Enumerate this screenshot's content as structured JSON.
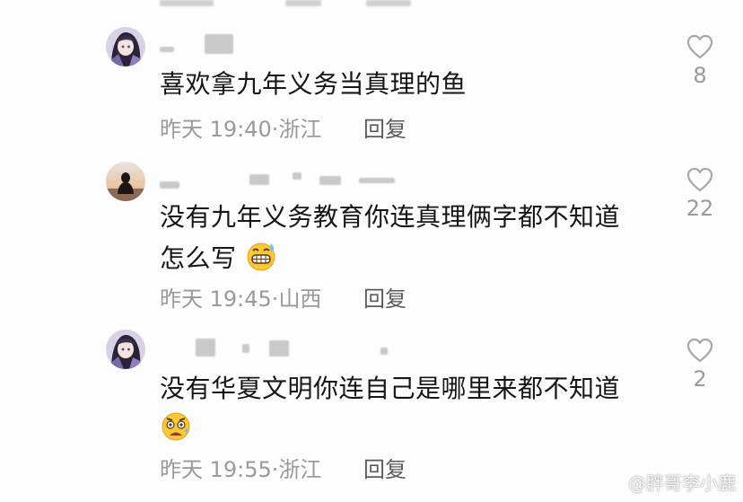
{
  "comments": [
    {
      "text": "喜欢拿九年义务当真理的鱼",
      "time": "昨天 19:40",
      "sep": "·",
      "location": "浙江",
      "reply_label": "回复",
      "likes": "8",
      "avatar": "anime-girl-avatar"
    },
    {
      "text_line1": "没有九年义务教育你连真理俩字都不知道",
      "text_line2": "怎么写",
      "emoji": "grinning-sweat-emoji",
      "time": "昨天 19:45",
      "sep": "·",
      "location": "山西",
      "reply_label": "回复",
      "likes": "22",
      "avatar": "silhouette-sunset-avatar"
    },
    {
      "text": "没有华夏文明你连自己是哪里来都不知道",
      "emoji": "frowning-sweat-emoji",
      "time": "昨天 19:55",
      "sep": "·",
      "location": "浙江",
      "reply_label": "回复",
      "likes": "2",
      "avatar": "anime-girl-avatar"
    }
  ],
  "watermark": {
    "text": "@胖哥李小鹿",
    "icon": "weibo-icon"
  },
  "colors": {
    "text": "#161616",
    "meta": "#9a9a9a",
    "reply": "#5a5a5a",
    "background": "#fdfdfd"
  }
}
